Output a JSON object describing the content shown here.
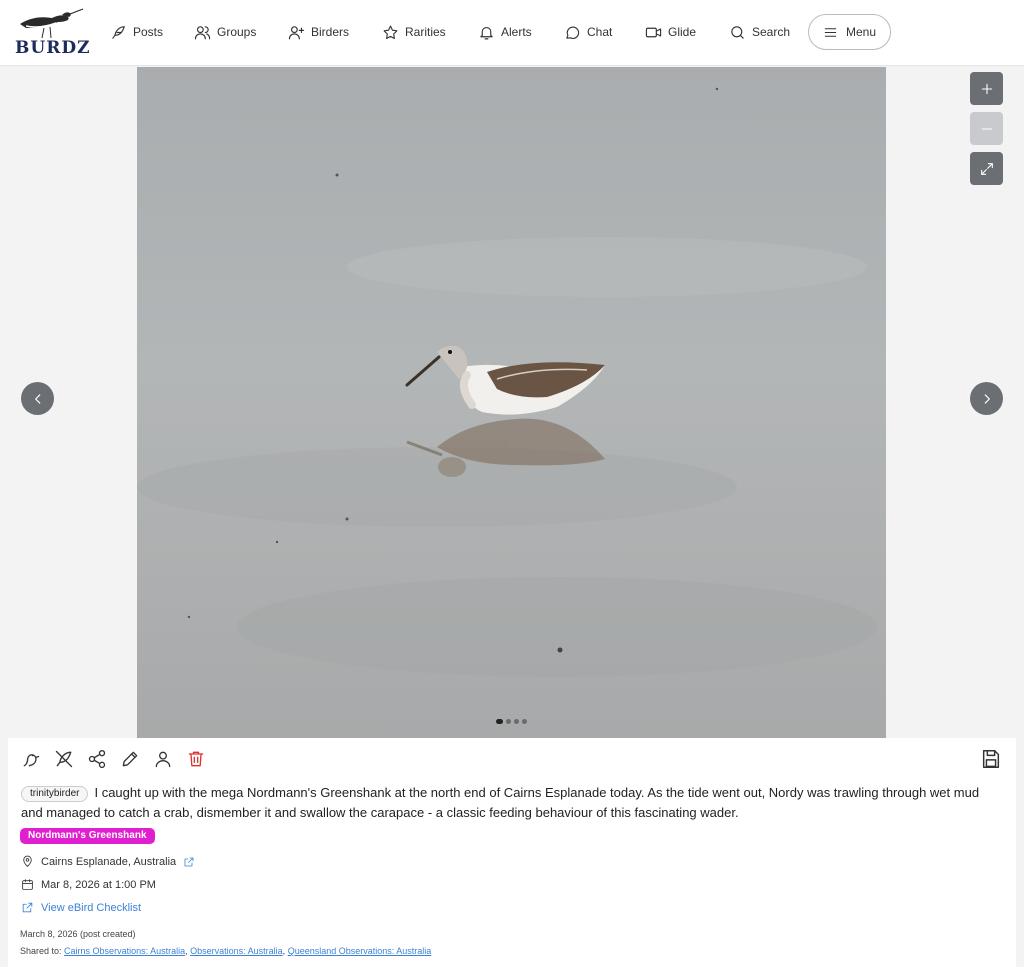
{
  "brand": {
    "name": "BURDZ"
  },
  "nav": {
    "items": [
      {
        "label": "Posts",
        "icon": "feather-icon"
      },
      {
        "label": "Groups",
        "icon": "users-icon"
      },
      {
        "label": "Birders",
        "icon": "user-plus-icon"
      },
      {
        "label": "Rarities",
        "icon": "star-icon"
      },
      {
        "label": "Alerts",
        "icon": "bell-icon"
      },
      {
        "label": "Chat",
        "icon": "chat-bubble-icon"
      },
      {
        "label": "Glide",
        "icon": "video-icon"
      },
      {
        "label": "Search",
        "icon": "search-icon"
      }
    ],
    "menu_label": "Menu"
  },
  "gallery": {
    "photo_subject": "wading bird",
    "slide_count": 4,
    "active_slide": 1,
    "controls": {
      "zoom_in": "+",
      "zoom_out": "−"
    }
  },
  "post": {
    "author": "trinitybirder",
    "text": "I caught up with the mega Nordmann's Greenshank at the north end of Cairns Esplanade today. As the tide went out, Nordy was trawling through wet mud and managed to catch a crab, dismember it and swallow the carapace - a classic feeding behaviour of this fascinating wader.",
    "species_tag": "Nordmann's Greenshank",
    "species_color": "#e020d0",
    "location": "Cairns Esplanade, Australia",
    "datetime": "Mar 8, 2026 at 1:00 PM",
    "ebird_link": "View eBird Checklist",
    "created": "March 8, 2026 (post created)",
    "shared_label": "Shared to:",
    "shared_to": [
      "Cairns Observations: Australia",
      "Observations: Australia",
      "Queensland Observations: Australia"
    ]
  },
  "colors": {
    "link": "#3b82d6",
    "delete": "#e03131",
    "control": "#6b6e73"
  }
}
